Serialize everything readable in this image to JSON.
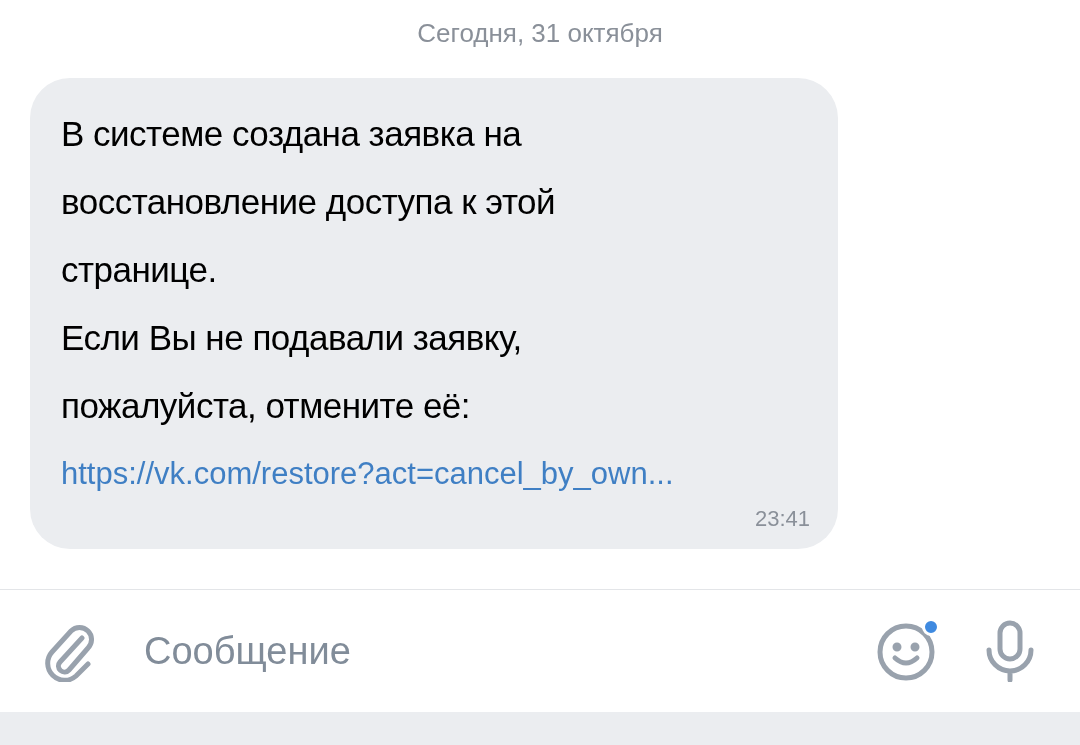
{
  "date_separator": "Сегодня, 31 октября",
  "message": {
    "paragraphs": [
      "В системе создана заявка на восстановление доступа к этой странице.",
      "Если Вы не подавали заявку, пожалуйста, отмените её:"
    ],
    "link": "https://vk.com/restore?act=cancel_by_own...",
    "time": "23:41"
  },
  "composer": {
    "placeholder": "Сообщение",
    "emoji_badge": true
  }
}
